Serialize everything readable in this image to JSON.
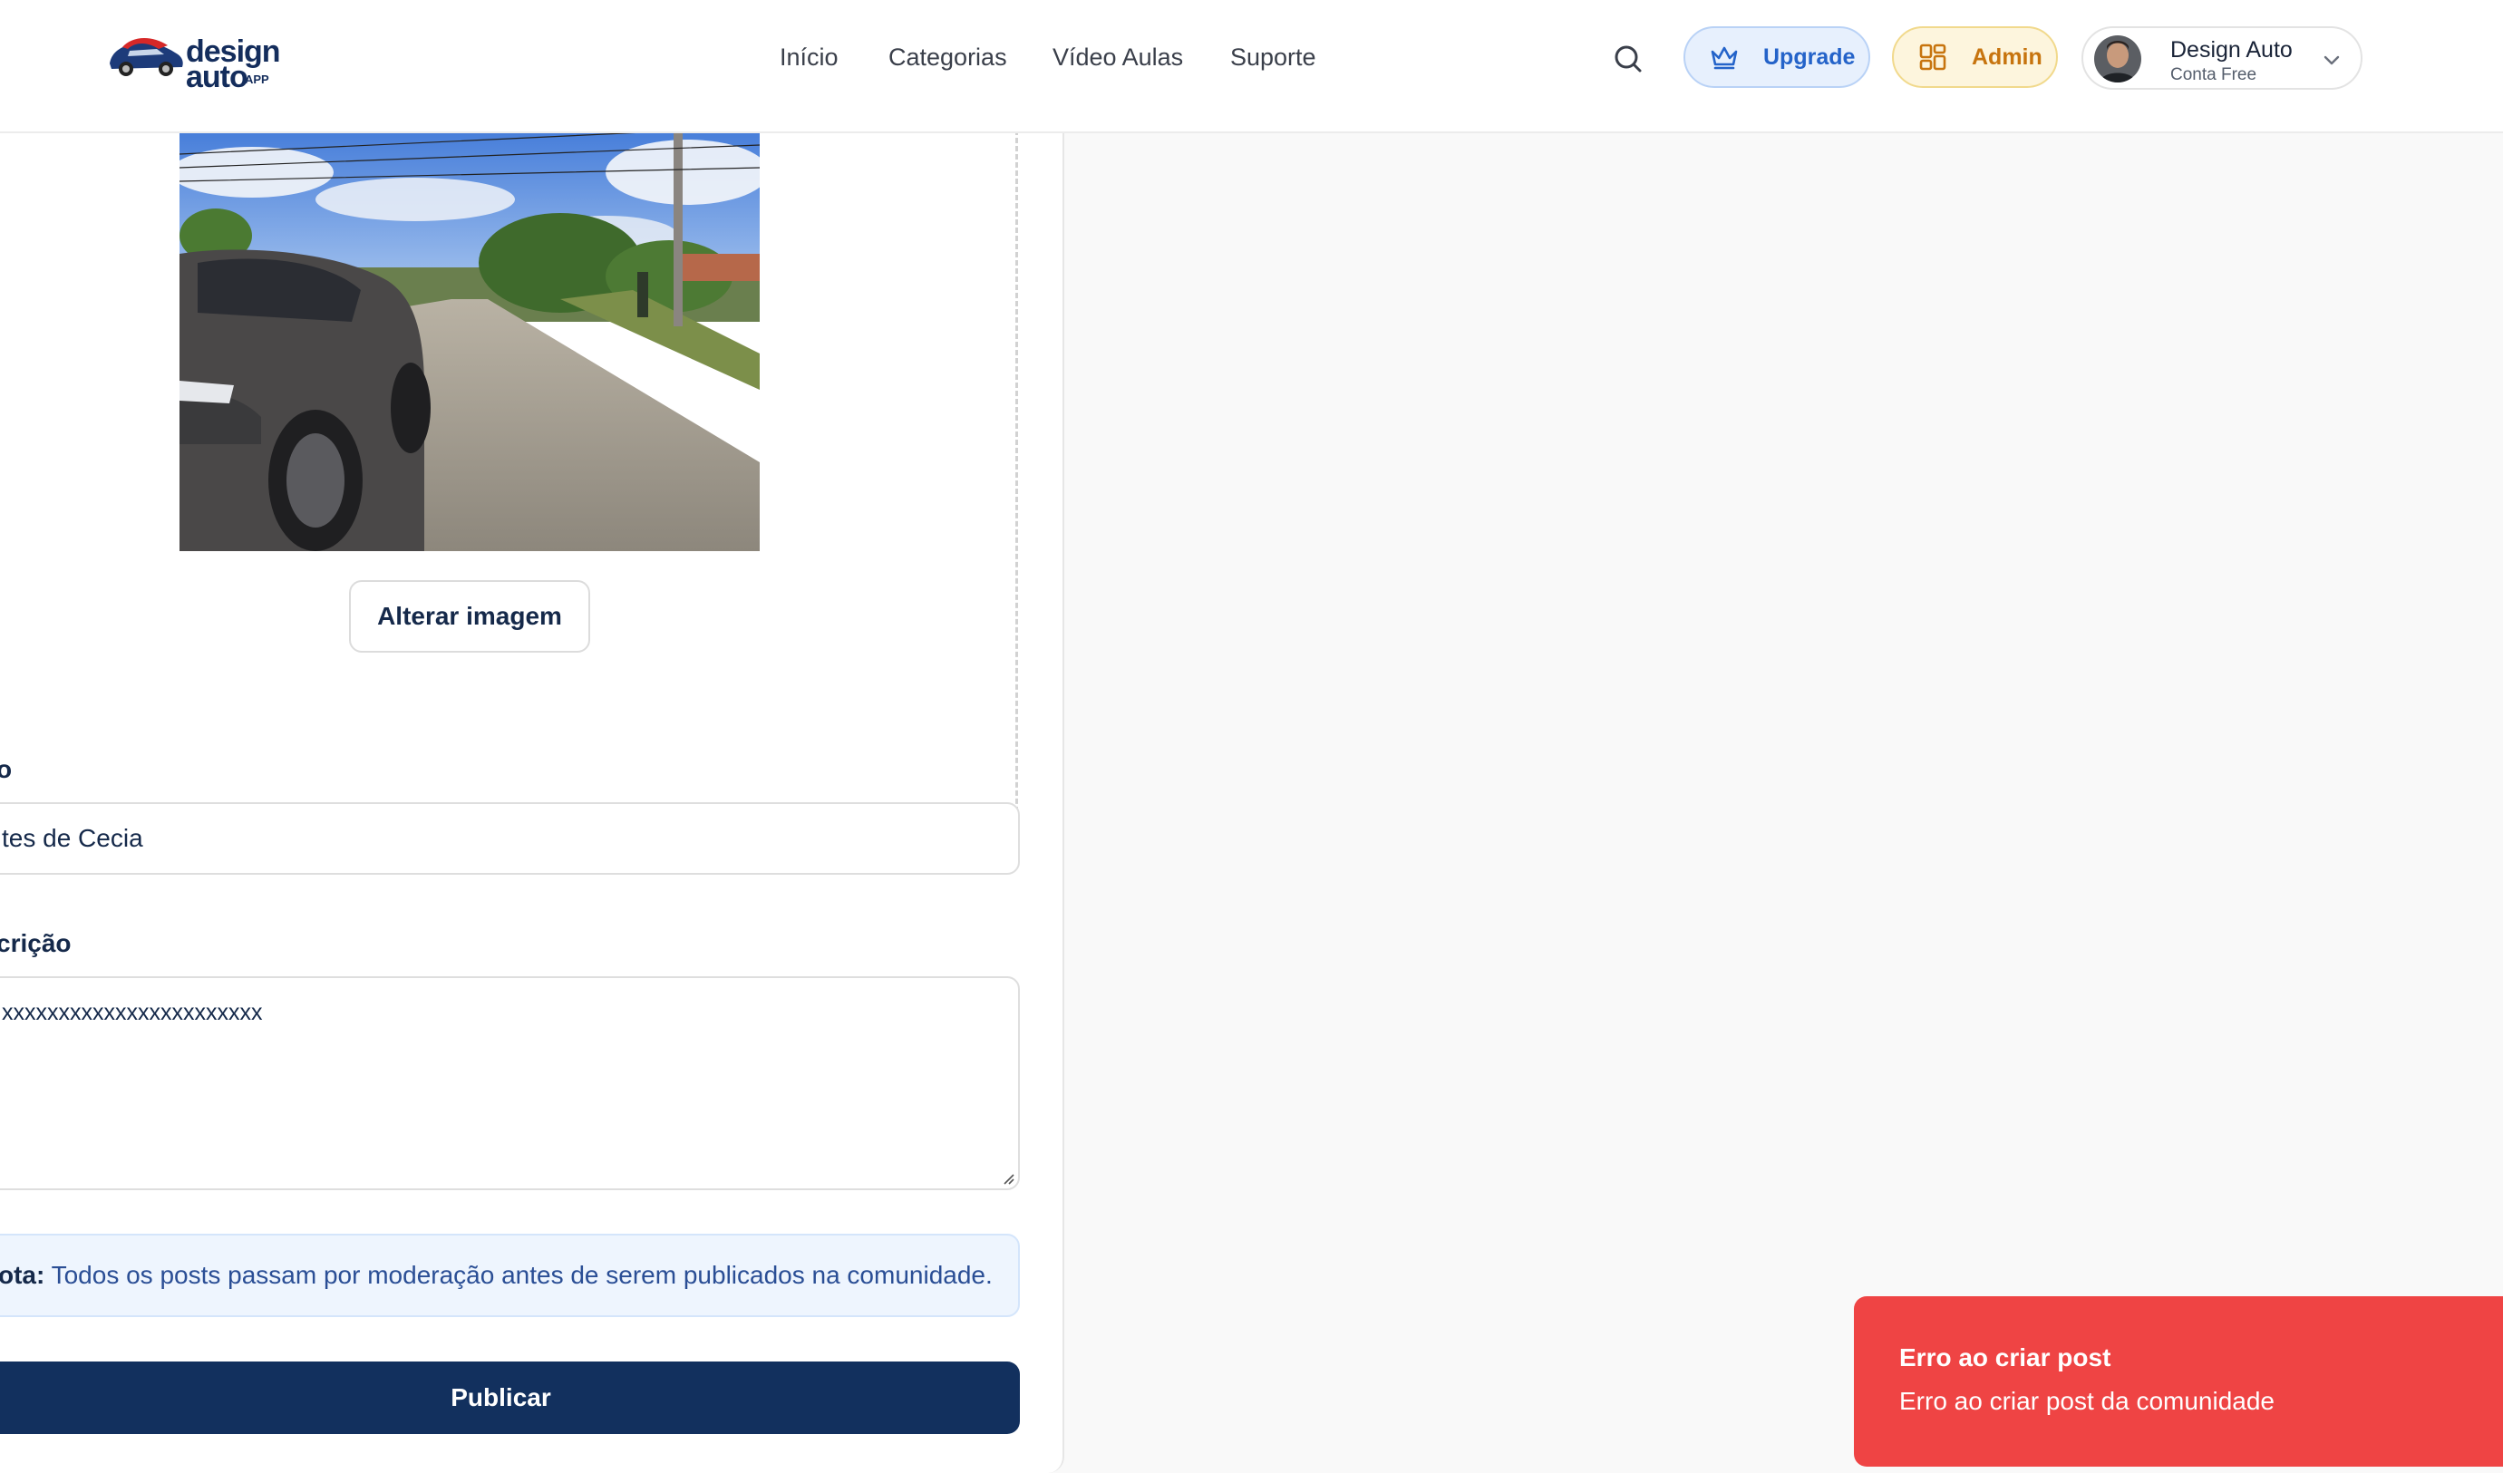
{
  "header": {
    "ghost_text": "",
    "logo": {
      "word1": "design",
      "word2": "auto",
      "suffix": "APP"
    },
    "nav": [
      "Início",
      "Categorias",
      "Vídeo Aulas",
      "Suporte"
    ],
    "upgrade_label": "Upgrade",
    "admin_label": "Admin",
    "user": {
      "name": "Design Auto",
      "plan": "Conta Free"
    },
    "icons": {
      "search": "search-icon",
      "upgrade": "crown-icon",
      "admin": "dashboard-grid-icon",
      "user_menu": "chevron-down-icon"
    }
  },
  "form": {
    "change_image_label": "Alterar imagem",
    "title_label": "o",
    "title_value": "tes de Cecia",
    "description_label": "crição",
    "description_value": "xxxxxxxxxxxxxxxxxxxxxxx",
    "note_bold": "ota:",
    "note_text": " Todos os posts passam por moderação antes de serem publicados na comunidade.",
    "publish_label": "Publicar"
  },
  "toast": {
    "title": "Erro ao criar post",
    "message": "Erro ao criar post da comunidade"
  },
  "colors": {
    "primary": "#12305e",
    "upgrade_accent": "#2463c9",
    "admin_accent": "#c7740e",
    "error": "#ef4444",
    "note_bg": "#eef5fe"
  }
}
